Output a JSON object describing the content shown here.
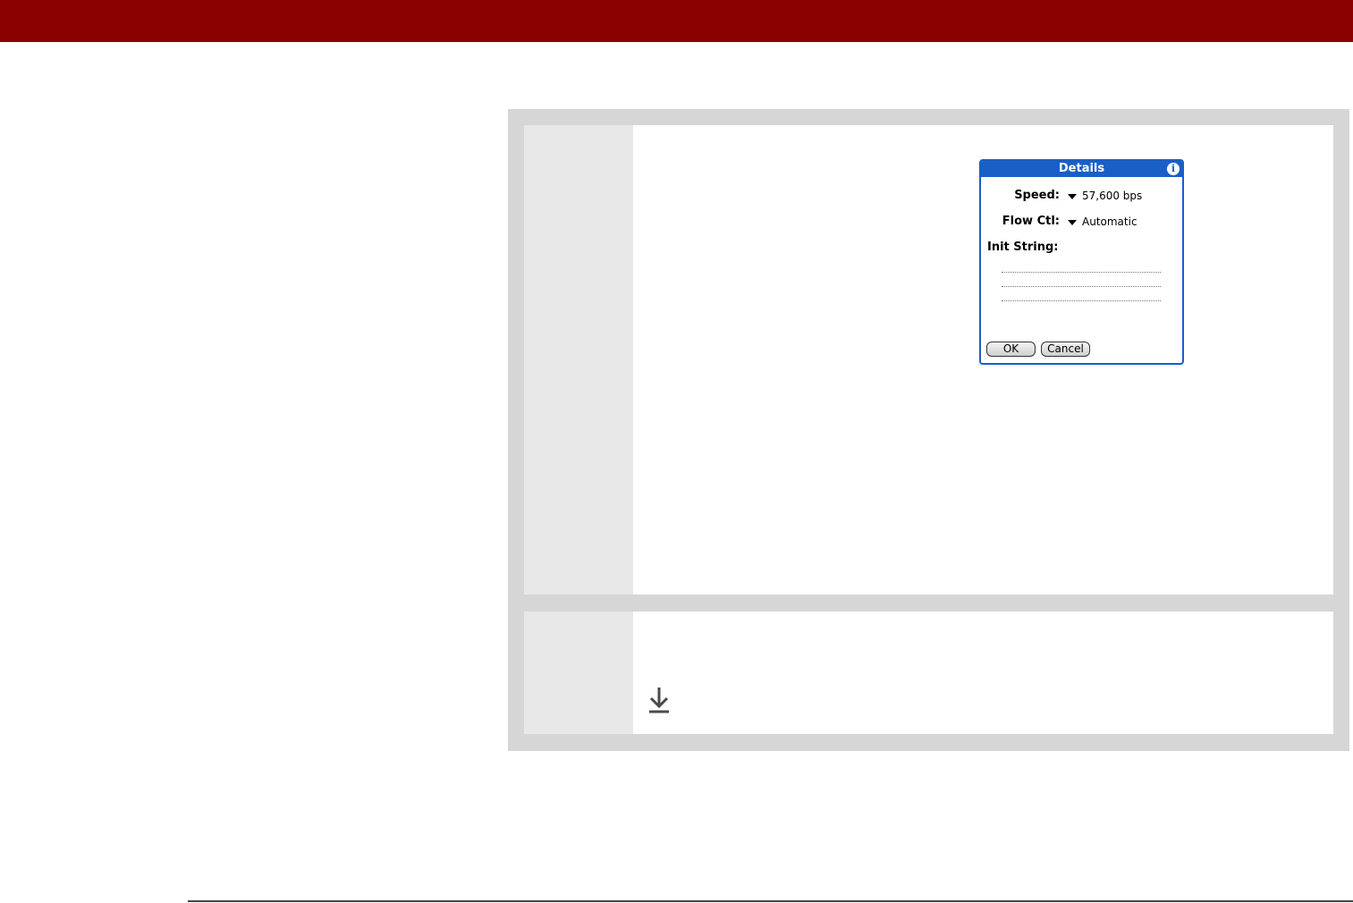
{
  "colors": {
    "banner": "#8b0000",
    "dialog_accent": "#1a5fc6",
    "panel": "#d6d6d6",
    "gutter": "#e8e8e8"
  },
  "dialog": {
    "title": "Details",
    "info_icon": "info-icon",
    "speed_label": "Speed:",
    "speed_value": "57,600 bps",
    "flow_label": "Flow Ctl:",
    "flow_value": "Automatic",
    "init_label": "Init String:",
    "ok_label": "OK",
    "cancel_label": "Cancel"
  },
  "step2": {
    "icon": "download-arrow-icon"
  }
}
